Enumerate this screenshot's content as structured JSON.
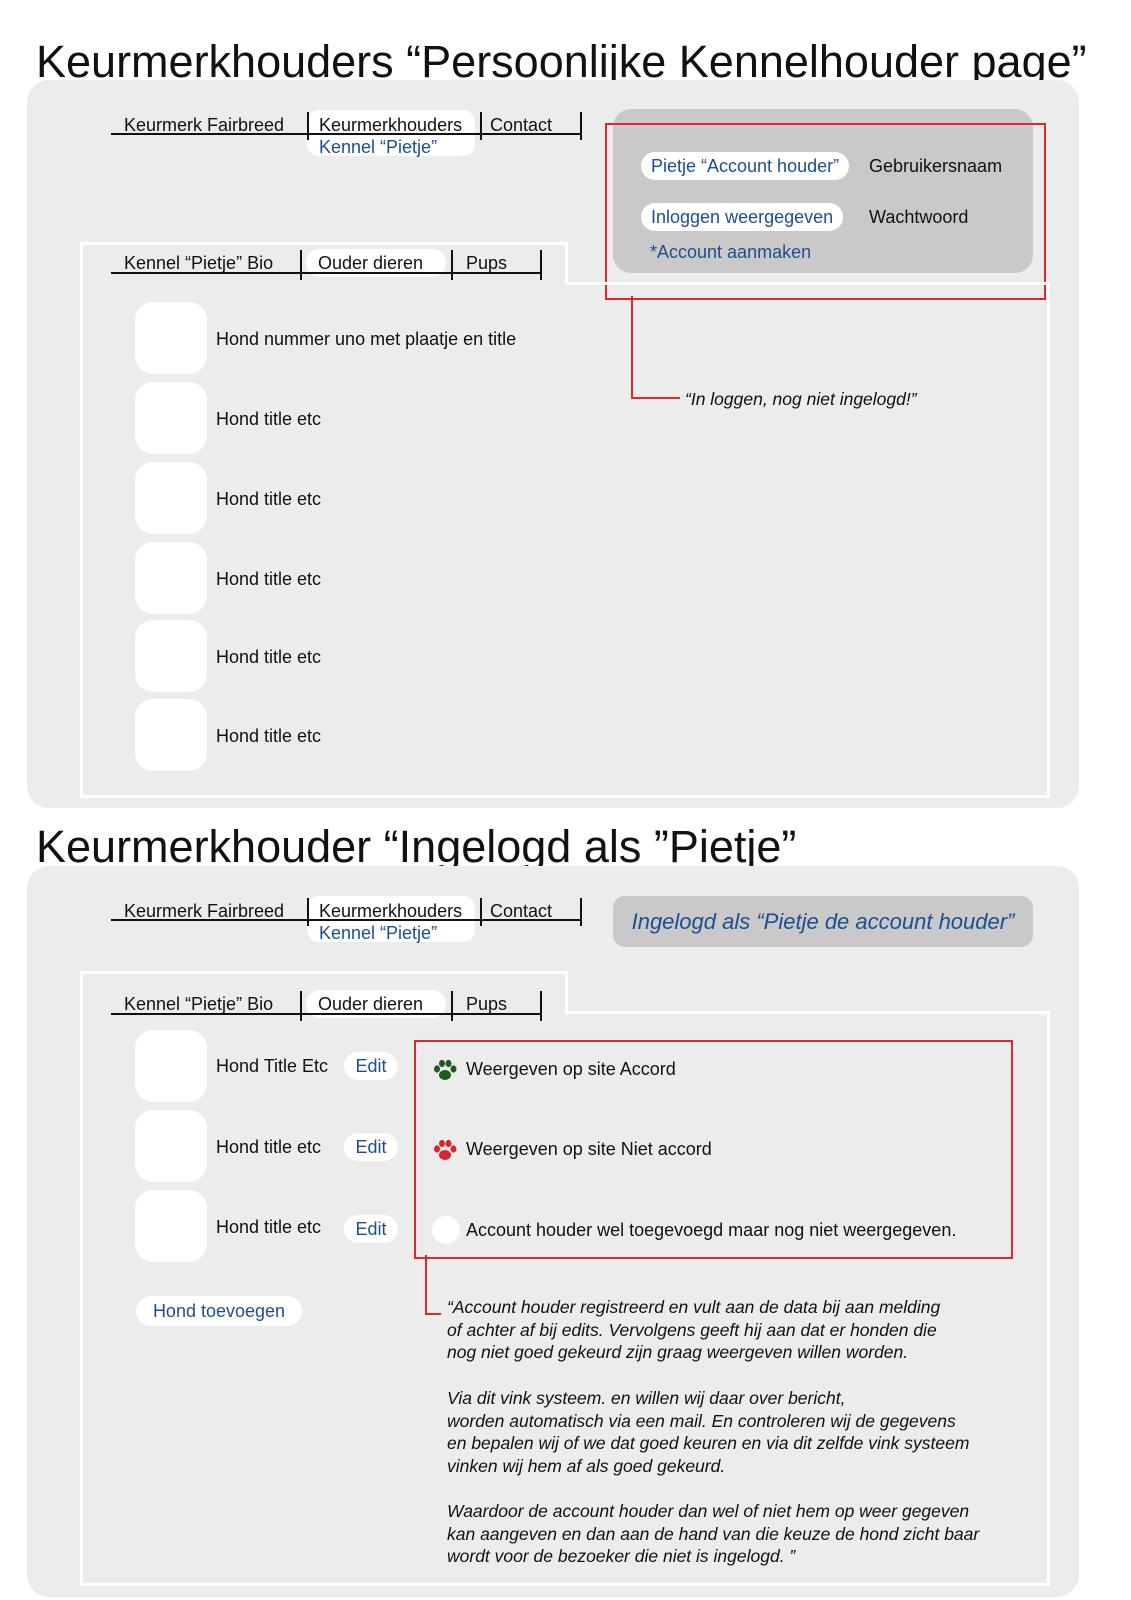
{
  "page_titles": {
    "top": "Keurmerkhouders “Persoonlijke Kennelhouder page”",
    "bottom": "Keurmerkhouder “Ingelogd als ”Pietje”"
  },
  "main_nav": {
    "items": [
      "Keurmerk Fairbreed",
      "Keurmerkhouders",
      "Contact"
    ],
    "sub_item": "Kennel “Pietje”"
  },
  "kennel_tabs": [
    "Kennel “Pietje” Bio",
    "Ouder dieren",
    "Pups"
  ],
  "login_panel": {
    "username_label": "Pietje “Account houder”",
    "username_value": "Gebruikersnaam",
    "password_label": "Inloggen weergegeven",
    "password_value": "Wachtwoord",
    "create_account": "*Account aanmaken"
  },
  "login_note": "“In loggen, nog niet ingelogd!”",
  "dog_list_public": [
    "Hond nummer uno met plaatje en title",
    "Hond title etc",
    "Hond title etc",
    "Hond title etc",
    "Hond title etc",
    "Hond title etc"
  ],
  "logged_in_badge": "Ingelogd als “Pietje de account houder”",
  "dog_list_owner": [
    {
      "title": "Hond Title Etc",
      "edit": "Edit"
    },
    {
      "title": "Hond title etc",
      "edit": "Edit"
    },
    {
      "title": "Hond title etc",
      "edit": "Edit"
    }
  ],
  "add_dog_button": "Hond toevoegen",
  "legend": [
    {
      "icon": "paw-icon-green",
      "color": "#1f5a1f",
      "text": "Weergeven op site Accord"
    },
    {
      "icon": "paw-icon-red",
      "color": "#d8262a",
      "text": "Weergeven op site Niet accord"
    },
    {
      "icon": "circle-icon-empty",
      "color": "#ffffff",
      "text": "Account houder wel toegevoegd maar nog niet weergegeven."
    }
  ],
  "explanation_paragraphs": [
    "“Account houder registreerd en vult aan de data bij aan melding\nof achter af bij edits. Vervolgens geeft hij aan dat er honden die\nnog niet goed gekeurd zijn graag weergeven willen worden.",
    "Via dit vink systeem. en willen wij daar over bericht,\nworden automatisch via een mail. En controleren wij de gegevens\nen bepalen wij of we dat goed keuren en via dit zelfde vink systeem\nvinken wij hem af als goed gekeurd.",
    "Waardoor de account houder dan wel of niet hem op weer gegeven\nkan aangeven en dan aan de hand van die keuze de hond zicht baar\nwordt voor de bezoeker die niet is ingelogd. ”"
  ],
  "colors": {
    "accent_blue": "#1d4e8f",
    "annotation_red": "#e0282b",
    "panel_grey": "#ececec"
  }
}
